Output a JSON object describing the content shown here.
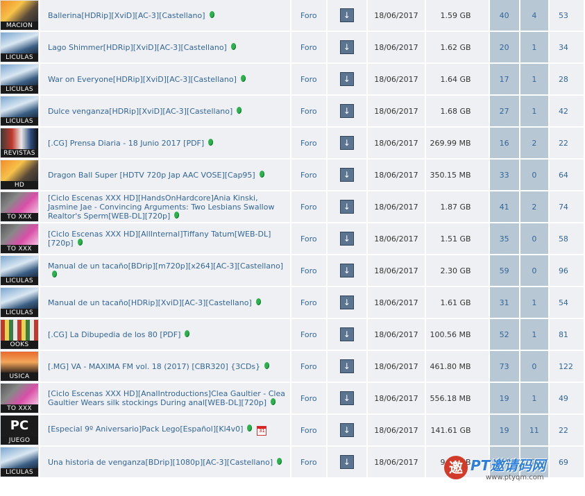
{
  "colors": {
    "link": "#336699",
    "row_bg": "#eef0f3",
    "stats_bg": "#b8c7d4",
    "gem": "#2bb24c"
  },
  "rows": [
    {
      "cat": "MACION",
      "name": "Ballerina[HDRip][XviD][AC-3][Castellano]",
      "foro": "Foro",
      "date": "18/06/2017",
      "size": "1.59 GB",
      "seeds": "40",
      "leech": "4",
      "comp": "53",
      "art": "anime"
    },
    {
      "cat": "LICULAS",
      "name": "Lago Shimmer[HDRip][XviD][AC-3][Castellano]",
      "foro": "Foro",
      "date": "18/06/2017",
      "size": "1.62 GB",
      "seeds": "20",
      "leech": "1",
      "comp": "34",
      "art": "movie"
    },
    {
      "cat": "LICULAS",
      "name": "War on Everyone[HDRip][XviD][AC-3][Castellano]",
      "foro": "Foro",
      "date": "18/06/2017",
      "size": "1.64 GB",
      "seeds": "17",
      "leech": "1",
      "comp": "28",
      "art": "movie"
    },
    {
      "cat": "LICULAS",
      "name": "Dulce venganza[HDRip][XviD][AC-3][Castellano]",
      "foro": "Foro",
      "date": "18/06/2017",
      "size": "1.68 GB",
      "seeds": "27",
      "leech": "1",
      "comp": "42",
      "art": "movie"
    },
    {
      "cat": "REVISTAS",
      "name": "[.CG] Prensa Diaria - 18 Junio 2017 [PDF]",
      "foro": "Foro",
      "date": "18/06/2017",
      "size": "269.99 MB",
      "seeds": "16",
      "leech": "2",
      "comp": "22",
      "art": "mag"
    },
    {
      "cat": "HD",
      "name": "Dragon Ball Super [HDTV 720p Jap AAC VOSE][Cap95]",
      "foro": "Foro",
      "date": "18/06/2017",
      "size": "350.15 MB",
      "seeds": "33",
      "leech": "0",
      "comp": "64",
      "art": "anime"
    },
    {
      "cat": "TO XXX",
      "name": "[Ciclo Escenas XXX HD][HandsOnHardcore]Ania Kinski, Jasmine Jae - Convincing Arguments: Two Lesbians Swallow Realtor's Sperm[WEB-DL][720p]",
      "foro": "Foro",
      "date": "18/06/2017",
      "size": "1.87 GB",
      "seeds": "41",
      "leech": "2",
      "comp": "74",
      "art": "xxx"
    },
    {
      "cat": "TO XXX",
      "name": "[Ciclo Escenas XXX HD][AllInternal]Tiffany Tatum[WEB-DL][720p]",
      "foro": "Foro",
      "date": "18/06/2017",
      "size": "1.51 GB",
      "seeds": "35",
      "leech": "0",
      "comp": "58",
      "art": "xxx"
    },
    {
      "cat": "LICULAS",
      "name": "Manual de un tacaño[BDrip][m720p][x264][AC-3][Castellano]",
      "foro": "Foro",
      "date": "18/06/2017",
      "size": "2.30 GB",
      "seeds": "59",
      "leech": "0",
      "comp": "96",
      "art": "movie"
    },
    {
      "cat": "LICULAS",
      "name": "Manual de un tacaño[HDRip][XviD][AC-3][Castellano]",
      "foro": "Foro",
      "date": "18/06/2017",
      "size": "1.61 GB",
      "seeds": "31",
      "leech": "1",
      "comp": "54",
      "art": "movie"
    },
    {
      "cat": "OOKS",
      "name": "[.CG] La Dibupedia de los 80 [PDF]",
      "foro": "Foro",
      "date": "18/06/2017",
      "size": "100.56 MB",
      "seeds": "52",
      "leech": "1",
      "comp": "81",
      "art": "books"
    },
    {
      "cat": "USICA",
      "name": "[.MG] VA - MAXIMA FM vol. 18 (2017) [CBR320] {3CDs}",
      "foro": "Foro",
      "date": "18/06/2017",
      "size": "461.80 MB",
      "seeds": "73",
      "leech": "0",
      "comp": "122",
      "art": "music"
    },
    {
      "cat": "TO XXX",
      "name": "[Ciclo Escenas XXX HD][AnalIntroductions]Clea Gaultier - Clea Gaultier Wears silk stockings During anal[WEB-DL][720p]",
      "foro": "Foro",
      "date": "18/06/2017",
      "size": "556.18 MB",
      "seeds": "19",
      "leech": "1",
      "comp": "49",
      "art": "xxx"
    },
    {
      "cat": "JUEGO",
      "name": "[Especial 9º Aniversario]Pack Lego[Español][Kl4v0]",
      "foro": "Foro",
      "date": "18/06/2017",
      "size": "141.61 GB",
      "seeds": "19",
      "leech": "11",
      "comp": "22",
      "art": "pc",
      "cal": true
    },
    {
      "cat": "LICULAS",
      "name": "Una historia de venganza[BDrip][1080p][AC-3][Castellano]",
      "foro": "Foro",
      "date": "18/06/2017",
      "size": "9.06 GB",
      "seeds": "34",
      "leech": "0",
      "comp": "69",
      "art": "movie"
    }
  ],
  "watermark": {
    "logo": "邀",
    "text": "PT邀请码网",
    "url": "www.ptyqm.com"
  }
}
